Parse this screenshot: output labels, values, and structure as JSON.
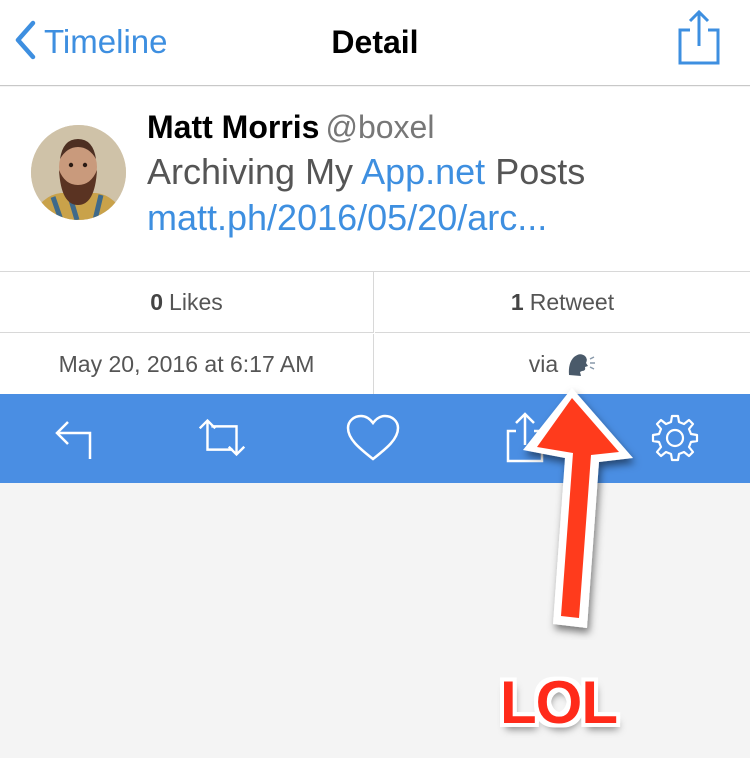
{
  "nav": {
    "back_label": "Timeline",
    "title": "Detail",
    "share_icon": "share-icon"
  },
  "tweet": {
    "author_name": "Matt Morris",
    "author_handle": "@boxel",
    "text_prefix": "Archiving My ",
    "text_link": "App.net",
    "text_suffix": " Posts",
    "url": "matt.ph/2016/05/20/arc..."
  },
  "stats": {
    "likes_count": "0",
    "likes_label": "Likes",
    "retweets_count": "1",
    "retweets_label": "Retweet",
    "timestamp": "May 20, 2016 at 6:17 AM",
    "via_label": "via",
    "via_icon": "speaking-head-icon"
  },
  "toolbar": {
    "icons": [
      "reply-icon",
      "retweet-icon",
      "heart-icon",
      "share-icon",
      "gear-icon"
    ]
  },
  "annotation": {
    "text": "LOL"
  },
  "colors": {
    "accent": "#3e8fe0",
    "toolbar_bg": "#4a8ee3",
    "annotation": "#ff2a1a"
  }
}
